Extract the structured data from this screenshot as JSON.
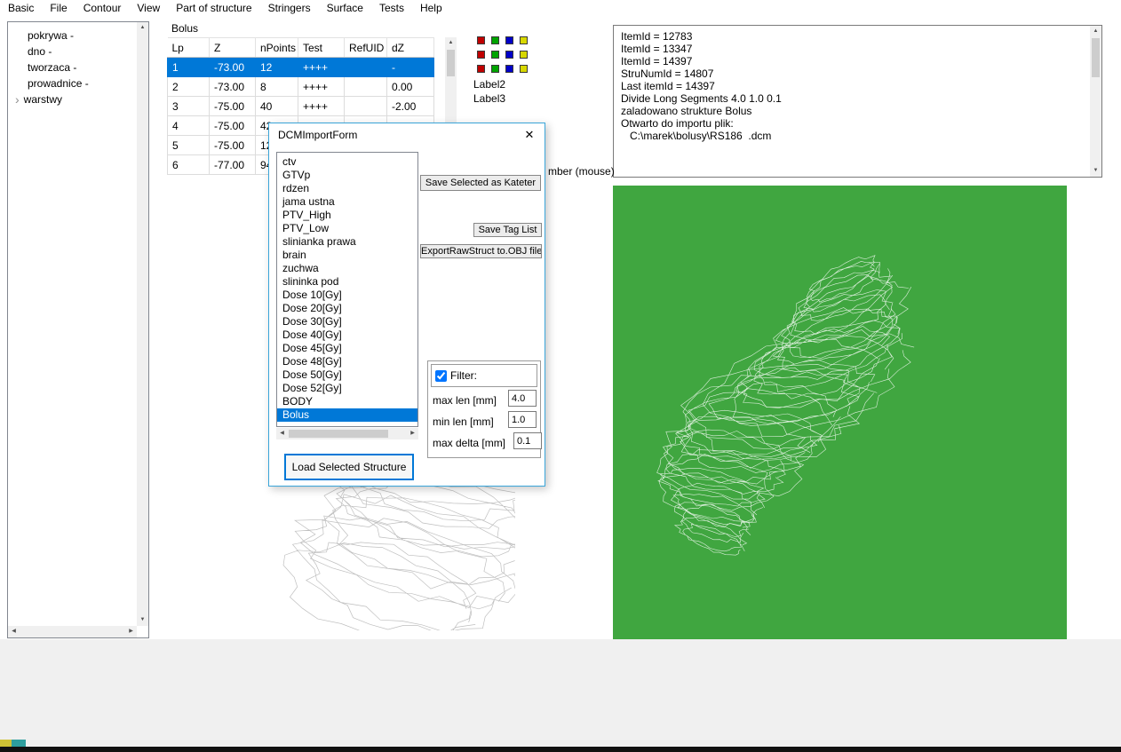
{
  "menu": {
    "items": [
      "Basic",
      "File",
      "Contour",
      "View",
      "Part of structure",
      "Stringers",
      "Surface",
      "Tests",
      "Help"
    ]
  },
  "tree": {
    "items": [
      "pokrywa -",
      "dno -",
      "tworzaca -",
      "prowadnice -",
      "warstwy"
    ]
  },
  "bolus": {
    "title": "Bolus",
    "columns": [
      "Lp",
      "Z",
      "nPoints",
      "Test",
      "RefUID",
      "dZ"
    ],
    "rows": [
      [
        "1",
        "-73.00",
        "12",
        "++++",
        "",
        "-"
      ],
      [
        "2",
        "-73.00",
        "8",
        "++++",
        "",
        "0.00"
      ],
      [
        "3",
        "-75.00",
        "40",
        "++++",
        "",
        "-2.00"
      ],
      [
        "4",
        "-75.00",
        "42",
        "",
        "",
        ""
      ],
      [
        "5",
        "-75.00",
        "12",
        "",
        "",
        ""
      ],
      [
        "6",
        "-77.00",
        "94",
        "",
        "",
        ""
      ]
    ],
    "selected_row_lp": "1"
  },
  "legend": {
    "labels": [
      "Label2",
      "Label3"
    ],
    "square_colors": [
      "#c00000",
      "#00a400",
      "#0000c8",
      "#d8d800"
    ],
    "styles": [
      "background-color:#c00000",
      "background-color:#00a400",
      "background-color:#0000c8",
      "background-color:#d8d800"
    ]
  },
  "log": {
    "lines": [
      "ItemId = 12783",
      "ItemId = 13347",
      "ItemId = 14397",
      "StruNumId = 14807",
      "Last itemId = 14397",
      "Divide Long Segments 4.0 1.0 0.1",
      "zaladowano strukture Bolus",
      "Otwarto do importu plik:",
      "   C:\\marek\\bolusy\\RS186  .dcm"
    ]
  },
  "partial_label": {
    "text": "mber (mouse)"
  },
  "dialog": {
    "title": "DCMImportForm",
    "structures": [
      "ctv",
      "GTVp",
      "rdzen",
      "jama ustna",
      "PTV_High",
      "PTV_Low",
      "slinianka prawa",
      "brain",
      "zuchwa",
      "slininka pod",
      "Dose 10[Gy]",
      "Dose 20[Gy]",
      "Dose 30[Gy]",
      "Dose 40[Gy]",
      "Dose 45[Gy]",
      "Dose 48[Gy]",
      "Dose 50[Gy]",
      "Dose 52[Gy]",
      "BODY",
      "Bolus"
    ],
    "selected_structure": "Bolus",
    "buttons": {
      "save_kateter": "Save Selected as Kateter",
      "save_taglist": "Save Tag List",
      "export_obj": "ExportRawStruct to.OBJ file",
      "load": "Load Selected Structure"
    },
    "filter": {
      "label": "Filter:",
      "checked": "checked",
      "fields": [
        {
          "label": "max len [mm]",
          "value": "4.0"
        },
        {
          "label": "min len [mm]",
          "value": "1.0"
        },
        {
          "label": "max delta [mm]",
          "value": "0.1"
        }
      ]
    }
  },
  "viewport": {
    "background": "#40a640",
    "style_bg": "background-color:#40a640"
  },
  "icons": {
    "up": "▲",
    "down": "▼",
    "left": "◀",
    "right": "▶",
    "close": "✕",
    "chevron_right": "›"
  },
  "colors": {
    "selection": "#0078d7",
    "dialog_border": "#3aa5d9",
    "viewport_green": "#40a640"
  }
}
